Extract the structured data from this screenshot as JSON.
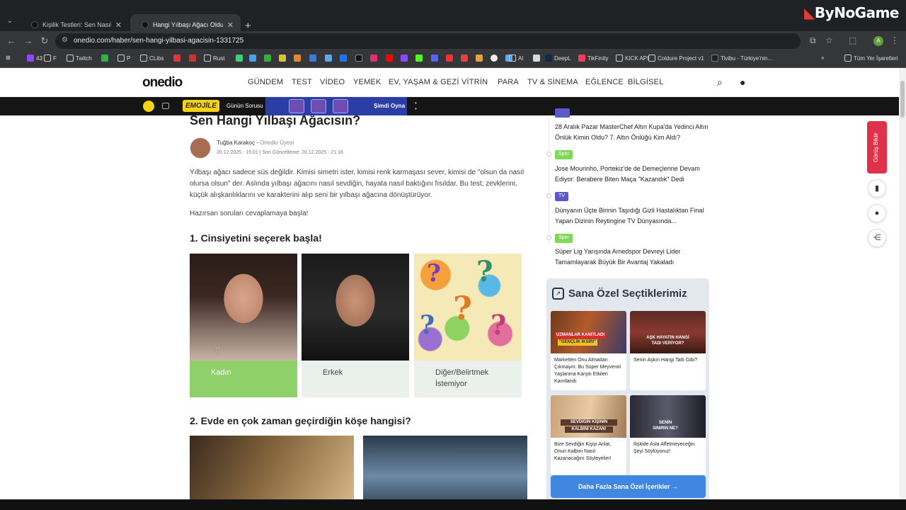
{
  "browser": {
    "tabs": [
      {
        "title": "Kişilik Testleri: Sen Nasıl Birisin?"
      },
      {
        "title": "Hangi Yılbaşı Ağacı Olduğunu G"
      }
    ],
    "url": "onedio.com/haber/sen-hangi-yilbasi-agacisin-1331725",
    "watermark": "ByNoGame",
    "profile_initial": "A",
    "bookmarks": [
      "43",
      "F",
      "Twitch",
      "P",
      "CLibs",
      "Rust",
      "DeepL",
      "TikFinity",
      "KICK API",
      "Coldure Project v1",
      "Tivibu - Türkiye'nin...",
      "Tüm Yer İşaretleri",
      "AI"
    ]
  },
  "site": {
    "logo": "onedio",
    "nav": [
      "GÜNDEM",
      "TEST",
      "VİDEO",
      "YEMEK",
      "EV, YAŞAM & GEZİ",
      "VİTRİN",
      "PARA",
      "TV & SİNEMA",
      "EĞLENCE",
      "BİLGİSEL"
    ],
    "promo": {
      "brand": "EMOJİLE",
      "label": "Günün Sorusu",
      "cta": "Şimdi Oyna"
    }
  },
  "article": {
    "title": "Sen Hangi Yılbaşı Ağacısın?",
    "author": "Tuğba Karakoç",
    "author_role": "Onedio Üyesi",
    "dates": "20.12.2025 - 15:01  |  Son Güncelleme: 20.12.2025 - 21:16",
    "intro": "Yılbaşı ağacı sadece süs değildir. Kimisi simetri ister, kimisi renk karmaşası sever, kimisi de \"olsun da nasıl olursa olsun\" der. Aslında yılbaşı ağacını nasıl sevdiğin, hayata nasıl baktığını fısıldar. Bu test; zevklerini, küçük alışkanlıklarını ve karakterini alıp seni bir yılbaşı ağacına dönüştürüyor.",
    "start_text": "Hazırsan soruları cevaplamaya başla!",
    "questions": [
      {
        "title": "1. Cinsiyetini seçerek başla!",
        "options": [
          {
            "label": "Kadın",
            "selected": true
          },
          {
            "label": "Erkek",
            "selected": false
          },
          {
            "label": "Diğer/Belirtmek İstemiyor",
            "selected": false
          }
        ]
      },
      {
        "title": "2. Evde en çok zaman geçirdiğin köşe hangisi?"
      }
    ]
  },
  "sidebar": {
    "news": [
      {
        "tag": "",
        "tag_color": "#5b58c9",
        "title": "28 Aralık Pazar MasterChef Altın Kupa'da Yedinci Altın Önlük Kimin Oldu? 7. Altın Önlüğü Kim Aldı?"
      },
      {
        "tag": "Spor",
        "tag_color": "#7ed957",
        "title": "Jose Mourinho, Portekiz'de de Demeçlerine Devam Ediyor: Berabere Biten Maça \"Kazandık\" Dedi"
      },
      {
        "tag": "TV",
        "tag_color": "#5b58c9",
        "title": "Dünyanın Üçte Birinin Taşıdığı Gizli Hastalıktan Final Yapan Dizinin Reytingine TV Dünyasında..."
      },
      {
        "tag": "Spor",
        "tag_color": "#7ed957",
        "title": "Süper Lig Yarışında Amedspor Devreyi Lider Tamamlayarak Büyük Bir Avantaj Yakaladı"
      }
    ],
    "special_title": "Sana Özel Seçtiklerimiz",
    "cards": [
      {
        "title": "Marketten Onu Almadan Çıkmayın: Bu Süper Meyvenin Yaşlanma Karşıtı Etkileri Kanıtlandı",
        "caption1": "UZMANLAR KANITLADI",
        "caption2": "\"GENÇLİK İKSİRİ\""
      },
      {
        "title": "Senin Aşkın Hangi Tatlı Gibi?",
        "caption1": "AŞK HAYATIN HANGİ",
        "caption2": "TADI VERİYOR?"
      },
      {
        "title": "Bize Sevdiğin Kişiyi Anlat, Onun Kalbini Nasıl Kazanacağını Söyleyelim!",
        "caption1": "SEVDİĞİN KİŞİNİN",
        "caption2": "KALBİNİ KAZAN!"
      },
      {
        "title": "İlişkide Asla Affetmeyeceğin Şeyi Söylüyoruz!",
        "caption1": "SENİN",
        "caption2": "SINIRIN NE?"
      }
    ],
    "more_button": "Daha Fazla Sana Özel İçerikler  →",
    "feedback": "Görüş Bildir"
  }
}
